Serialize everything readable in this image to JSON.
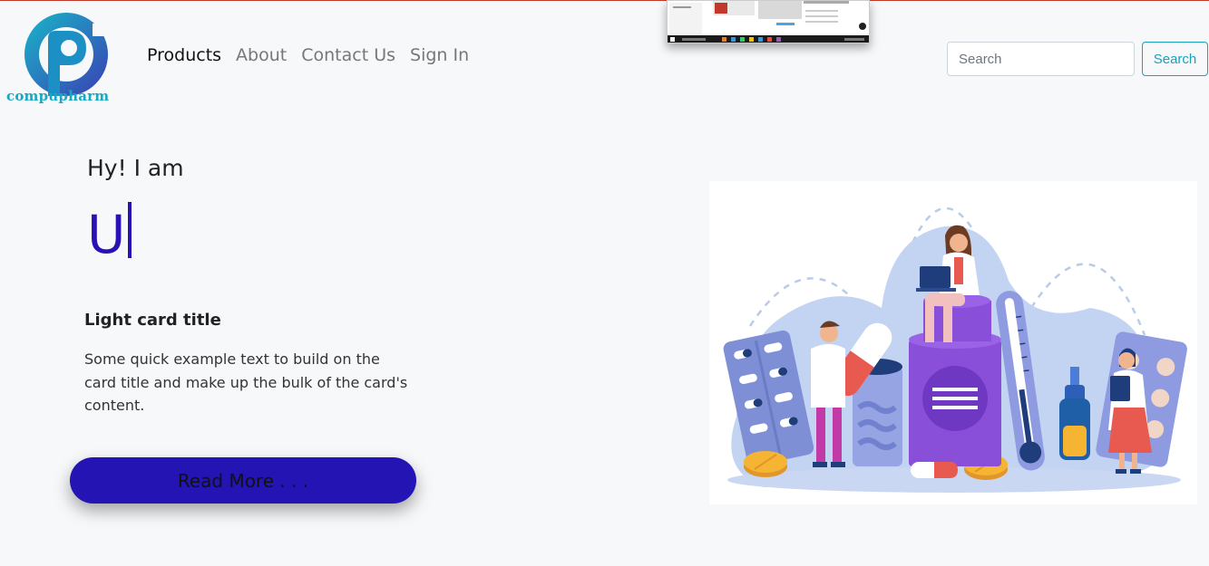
{
  "brand": {
    "name": "compupharm"
  },
  "nav": {
    "items": [
      "Products",
      "About",
      "Contact Us",
      "Sign In"
    ],
    "active_index": 0
  },
  "search": {
    "placeholder": "Search",
    "button_label": "Search"
  },
  "hero": {
    "greeting": "Hy! I am",
    "typed_text": "U"
  },
  "card": {
    "title": "Light card title",
    "text": "Some quick example text to build on the card title and make up the bulk of the card's content."
  },
  "cta": {
    "label": "Read More . . ."
  },
  "colors": {
    "accent": "#2414b3",
    "typed": "#2a10b5",
    "brand_teal": "#18a9c2",
    "info": "#17a2b8"
  },
  "icons": {
    "logo": "compupharm-p-logo-icon",
    "illustration": "pharmacy-illustration"
  }
}
